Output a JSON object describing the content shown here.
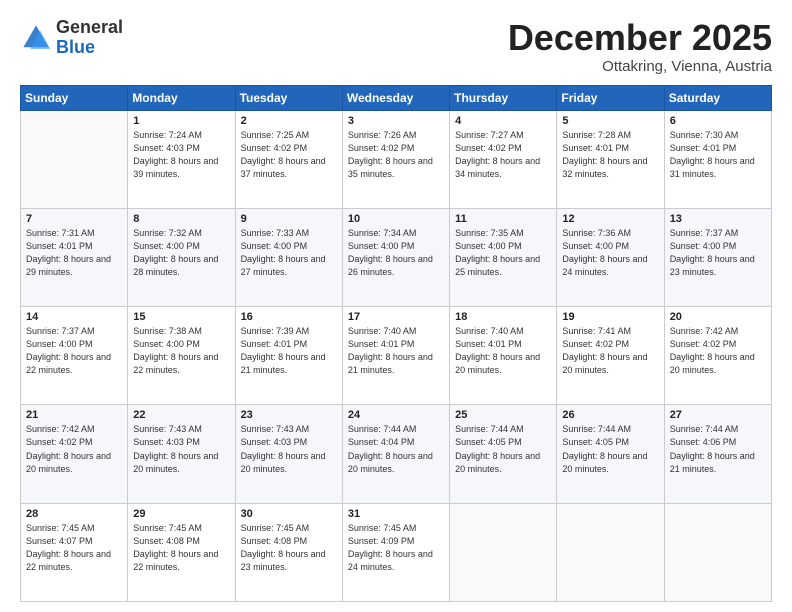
{
  "header": {
    "logo": {
      "general": "General",
      "blue": "Blue"
    },
    "title": "December 2025",
    "location": "Ottakring, Vienna, Austria"
  },
  "weekdays": [
    "Sunday",
    "Monday",
    "Tuesday",
    "Wednesday",
    "Thursday",
    "Friday",
    "Saturday"
  ],
  "weeks": [
    [
      {
        "day": "",
        "sunrise": "",
        "sunset": "",
        "daylight": ""
      },
      {
        "day": "1",
        "sunrise": "Sunrise: 7:24 AM",
        "sunset": "Sunset: 4:03 PM",
        "daylight": "Daylight: 8 hours and 39 minutes."
      },
      {
        "day": "2",
        "sunrise": "Sunrise: 7:25 AM",
        "sunset": "Sunset: 4:02 PM",
        "daylight": "Daylight: 8 hours and 37 minutes."
      },
      {
        "day": "3",
        "sunrise": "Sunrise: 7:26 AM",
        "sunset": "Sunset: 4:02 PM",
        "daylight": "Daylight: 8 hours and 35 minutes."
      },
      {
        "day": "4",
        "sunrise": "Sunrise: 7:27 AM",
        "sunset": "Sunset: 4:02 PM",
        "daylight": "Daylight: 8 hours and 34 minutes."
      },
      {
        "day": "5",
        "sunrise": "Sunrise: 7:28 AM",
        "sunset": "Sunset: 4:01 PM",
        "daylight": "Daylight: 8 hours and 32 minutes."
      },
      {
        "day": "6",
        "sunrise": "Sunrise: 7:30 AM",
        "sunset": "Sunset: 4:01 PM",
        "daylight": "Daylight: 8 hours and 31 minutes."
      }
    ],
    [
      {
        "day": "7",
        "sunrise": "Sunrise: 7:31 AM",
        "sunset": "Sunset: 4:01 PM",
        "daylight": "Daylight: 8 hours and 29 minutes."
      },
      {
        "day": "8",
        "sunrise": "Sunrise: 7:32 AM",
        "sunset": "Sunset: 4:00 PM",
        "daylight": "Daylight: 8 hours and 28 minutes."
      },
      {
        "day": "9",
        "sunrise": "Sunrise: 7:33 AM",
        "sunset": "Sunset: 4:00 PM",
        "daylight": "Daylight: 8 hours and 27 minutes."
      },
      {
        "day": "10",
        "sunrise": "Sunrise: 7:34 AM",
        "sunset": "Sunset: 4:00 PM",
        "daylight": "Daylight: 8 hours and 26 minutes."
      },
      {
        "day": "11",
        "sunrise": "Sunrise: 7:35 AM",
        "sunset": "Sunset: 4:00 PM",
        "daylight": "Daylight: 8 hours and 25 minutes."
      },
      {
        "day": "12",
        "sunrise": "Sunrise: 7:36 AM",
        "sunset": "Sunset: 4:00 PM",
        "daylight": "Daylight: 8 hours and 24 minutes."
      },
      {
        "day": "13",
        "sunrise": "Sunrise: 7:37 AM",
        "sunset": "Sunset: 4:00 PM",
        "daylight": "Daylight: 8 hours and 23 minutes."
      }
    ],
    [
      {
        "day": "14",
        "sunrise": "Sunrise: 7:37 AM",
        "sunset": "Sunset: 4:00 PM",
        "daylight": "Daylight: 8 hours and 22 minutes."
      },
      {
        "day": "15",
        "sunrise": "Sunrise: 7:38 AM",
        "sunset": "Sunset: 4:00 PM",
        "daylight": "Daylight: 8 hours and 22 minutes."
      },
      {
        "day": "16",
        "sunrise": "Sunrise: 7:39 AM",
        "sunset": "Sunset: 4:01 PM",
        "daylight": "Daylight: 8 hours and 21 minutes."
      },
      {
        "day": "17",
        "sunrise": "Sunrise: 7:40 AM",
        "sunset": "Sunset: 4:01 PM",
        "daylight": "Daylight: 8 hours and 21 minutes."
      },
      {
        "day": "18",
        "sunrise": "Sunrise: 7:40 AM",
        "sunset": "Sunset: 4:01 PM",
        "daylight": "Daylight: 8 hours and 20 minutes."
      },
      {
        "day": "19",
        "sunrise": "Sunrise: 7:41 AM",
        "sunset": "Sunset: 4:02 PM",
        "daylight": "Daylight: 8 hours and 20 minutes."
      },
      {
        "day": "20",
        "sunrise": "Sunrise: 7:42 AM",
        "sunset": "Sunset: 4:02 PM",
        "daylight": "Daylight: 8 hours and 20 minutes."
      }
    ],
    [
      {
        "day": "21",
        "sunrise": "Sunrise: 7:42 AM",
        "sunset": "Sunset: 4:02 PM",
        "daylight": "Daylight: 8 hours and 20 minutes."
      },
      {
        "day": "22",
        "sunrise": "Sunrise: 7:43 AM",
        "sunset": "Sunset: 4:03 PM",
        "daylight": "Daylight: 8 hours and 20 minutes."
      },
      {
        "day": "23",
        "sunrise": "Sunrise: 7:43 AM",
        "sunset": "Sunset: 4:03 PM",
        "daylight": "Daylight: 8 hours and 20 minutes."
      },
      {
        "day": "24",
        "sunrise": "Sunrise: 7:44 AM",
        "sunset": "Sunset: 4:04 PM",
        "daylight": "Daylight: 8 hours and 20 minutes."
      },
      {
        "day": "25",
        "sunrise": "Sunrise: 7:44 AM",
        "sunset": "Sunset: 4:05 PM",
        "daylight": "Daylight: 8 hours and 20 minutes."
      },
      {
        "day": "26",
        "sunrise": "Sunrise: 7:44 AM",
        "sunset": "Sunset: 4:05 PM",
        "daylight": "Daylight: 8 hours and 20 minutes."
      },
      {
        "day": "27",
        "sunrise": "Sunrise: 7:44 AM",
        "sunset": "Sunset: 4:06 PM",
        "daylight": "Daylight: 8 hours and 21 minutes."
      }
    ],
    [
      {
        "day": "28",
        "sunrise": "Sunrise: 7:45 AM",
        "sunset": "Sunset: 4:07 PM",
        "daylight": "Daylight: 8 hours and 22 minutes."
      },
      {
        "day": "29",
        "sunrise": "Sunrise: 7:45 AM",
        "sunset": "Sunset: 4:08 PM",
        "daylight": "Daylight: 8 hours and 22 minutes."
      },
      {
        "day": "30",
        "sunrise": "Sunrise: 7:45 AM",
        "sunset": "Sunset: 4:08 PM",
        "daylight": "Daylight: 8 hours and 23 minutes."
      },
      {
        "day": "31",
        "sunrise": "Sunrise: 7:45 AM",
        "sunset": "Sunset: 4:09 PM",
        "daylight": "Daylight: 8 hours and 24 minutes."
      },
      {
        "day": "",
        "sunrise": "",
        "sunset": "",
        "daylight": ""
      },
      {
        "day": "",
        "sunrise": "",
        "sunset": "",
        "daylight": ""
      },
      {
        "day": "",
        "sunrise": "",
        "sunset": "",
        "daylight": ""
      }
    ]
  ]
}
